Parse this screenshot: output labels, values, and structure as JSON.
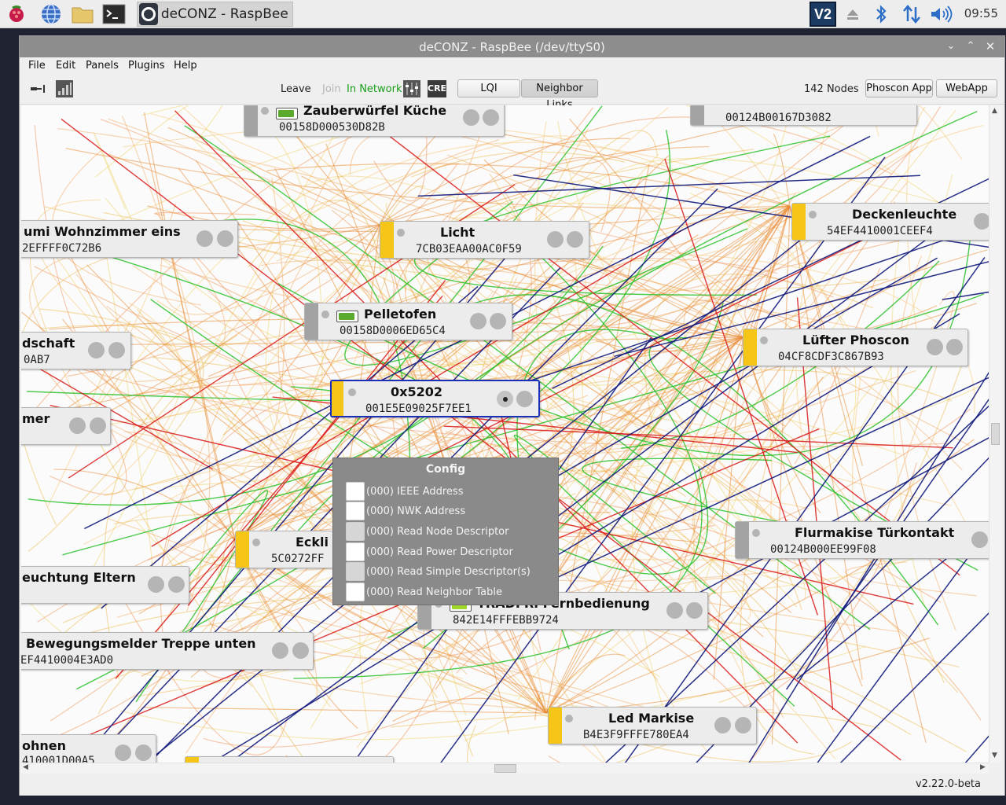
{
  "taskbar": {
    "task_title": "deCONZ - RaspBee (/...",
    "clock": "09:55",
    "launchers": [
      "raspberry-menu-icon",
      "browser-globe-icon",
      "file-manager-icon",
      "terminal-icon"
    ],
    "tray_icons": [
      "vnc-icon",
      "eject-icon",
      "bluetooth-icon",
      "network-icon",
      "volume-icon"
    ]
  },
  "window": {
    "title": "deCONZ - RaspBee (/dev/ttyS0)",
    "controls": [
      "chevron-down-icon",
      "chevron-up-icon",
      "close-icon"
    ]
  },
  "menu": {
    "items": [
      "File",
      "Edit",
      "Panels",
      "Plugins",
      "Help"
    ]
  },
  "toolbar": {
    "leave": "Leave",
    "join": "Join",
    "status": "In Network",
    "cre": "CRE",
    "lqi": "LQI",
    "neighbor_links": "Neighbor Links",
    "nodes_count": "142 Nodes",
    "phoscon_app": "Phoscon App",
    "webapp": "WebApp"
  },
  "colors": {
    "router": "#f5c518",
    "end_device": "#a3a3a3",
    "battery_full": "#5aaa2e",
    "battery_high": "#9fd82a",
    "selection": "#1a2fb8",
    "in_network": "#1a9e1a"
  },
  "nodes": [
    {
      "name": "Zauberwürfel Küche",
      "mac": "00158D000530D82B",
      "type": "end_device",
      "battery": 0.9,
      "battery_color": "#5aaa2e"
    },
    {
      "name": "",
      "mac": "00124B00167D3082",
      "type": "end_device"
    },
    {
      "name": "umi Wohnzimmer eins",
      "mac": "2EFFFF0C72B6",
      "type": "router"
    },
    {
      "name": "Licht",
      "mac": "7CB03EAA00AC0F59",
      "type": "router"
    },
    {
      "name": "Deckenleuchte",
      "mac": "54EF4410001CEEF4",
      "type": "router"
    },
    {
      "name": "Pelletofen",
      "mac": "00158D0006ED65C4",
      "type": "end_device",
      "battery": 0.9,
      "battery_color": "#5aaa2e"
    },
    {
      "name": "dschaft",
      "mac": "0AB7",
      "type": "router"
    },
    {
      "name": "Lüfter Phoscon",
      "mac": "04CF8CDF3C867B93",
      "type": "router"
    },
    {
      "name": "0x5202",
      "mac": "001E5E09025F7EE1",
      "type": "router",
      "selected": true
    },
    {
      "name": "mer",
      "mac": "",
      "type": "router"
    },
    {
      "name": "Flurmakise Türkontakt",
      "mac": "00124B000EE99F08",
      "type": "end_device"
    },
    {
      "name": "Eckli",
      "mac": "5C0272FF",
      "type": "router"
    },
    {
      "name": "euchtung Eltern",
      "mac": "",
      "type": "router"
    },
    {
      "name": "TRÅDFRI Fernbedienung",
      "mac": "842E14FFFEBB9724",
      "type": "end_device",
      "battery": 0.85,
      "battery_color": "#9fd82a"
    },
    {
      "name": "Bewegungsmelder Treppe unten",
      "mac": "EF4410004E3AD0",
      "type": "end_device"
    },
    {
      "name": "Led Markise",
      "mac": "B4E3F9FFFE780EA4",
      "type": "router"
    },
    {
      "name": "ohnen",
      "mac": "410001D00A5",
      "type": "router"
    }
  ],
  "context_menu": {
    "title": "Config",
    "items": [
      "(000) IEEE Address",
      "(000) NWK Address",
      "(000) Read Node Descriptor",
      "(000) Read Power Descriptor",
      "(000) Read Simple Descriptor(s)",
      "(000) Read Neighbor Table"
    ]
  },
  "status": {
    "version": "v2.22.0-beta"
  }
}
